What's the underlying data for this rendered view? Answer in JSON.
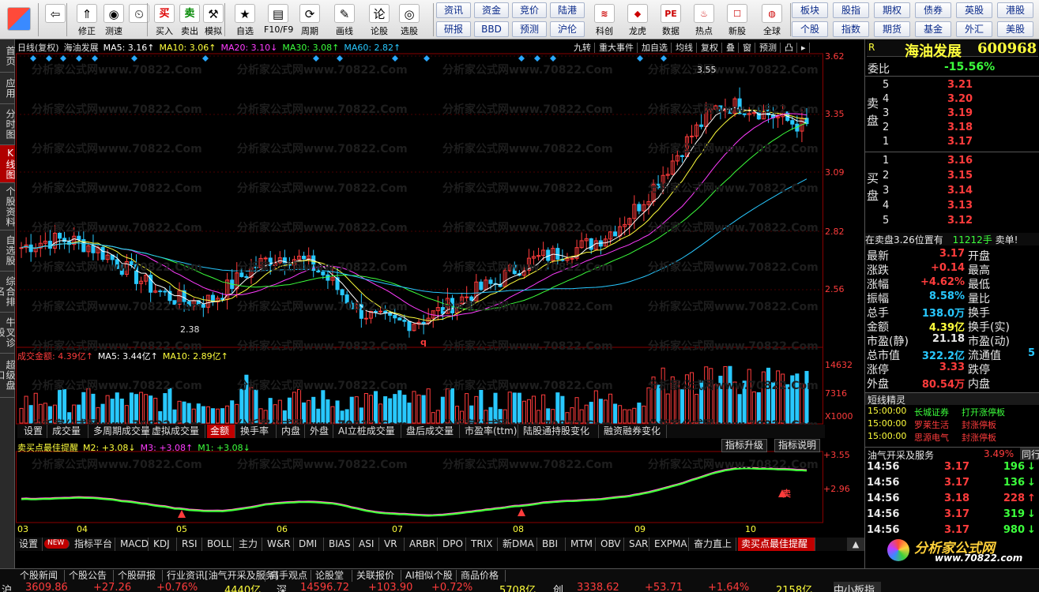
{
  "toolbar": {
    "buttons": [
      {
        "name": "back-button",
        "label": "",
        "icon": "⇦"
      },
      {
        "name": "revise-button",
        "label": "修正",
        "icon": "⇑"
      },
      {
        "name": "replay-button",
        "label": "测速",
        "icon": "◉"
      },
      {
        "name": "clock-button",
        "label": "",
        "icon": "⏲"
      },
      {
        "name": "buy-button",
        "label": "买入",
        "icon": "买"
      },
      {
        "name": "sell-button",
        "label": "卖出",
        "icon": "卖"
      },
      {
        "name": "simulate-button",
        "label": "模拟",
        "icon": "⚒"
      },
      {
        "name": "self-select-button",
        "label": "自选",
        "icon": "★"
      },
      {
        "name": "f10-button",
        "label": "F10/F9",
        "icon": "▤"
      },
      {
        "name": "period-button",
        "label": "周期",
        "icon": "⟳"
      },
      {
        "name": "draw-button",
        "label": "画线",
        "icon": "✎"
      },
      {
        "name": "discuss-button",
        "label": "论股",
        "icon": "论"
      },
      {
        "name": "select-stock-button",
        "label": "选股",
        "icon": "◎"
      }
    ],
    "small_buttons": [
      "资讯",
      "资金",
      "竞价",
      "陆港",
      "研报",
      "BBD",
      "预测",
      "沪伦"
    ],
    "icon_buttons": [
      {
        "name": "kechuang-button",
        "label": "科创",
        "icon": "≋"
      },
      {
        "name": "longhu-button",
        "label": "龙虎",
        "icon": "◆"
      },
      {
        "name": "data-button",
        "label": "数据",
        "icon": "PE"
      },
      {
        "name": "hotspot-button",
        "label": "热点",
        "icon": "♨"
      },
      {
        "name": "new-stock-button",
        "label": "新股",
        "icon": "☐"
      },
      {
        "name": "global-button",
        "label": "全球",
        "icon": "◍"
      }
    ],
    "right_buttons": [
      "板块",
      "股指",
      "期权",
      "债券",
      "英股",
      "港股",
      "个股",
      "指数",
      "期货",
      "基金",
      "外汇",
      "美股"
    ]
  },
  "left_nav": [
    {
      "label": "首页",
      "active": false
    },
    {
      "label": "应用",
      "active": false
    },
    {
      "label": "分时图",
      "active": false
    },
    {
      "label": "K线图",
      "active": true
    },
    {
      "label": "个股资料",
      "active": false
    },
    {
      "label": "自选股",
      "active": false
    },
    {
      "label": "综合排名",
      "active": false
    },
    {
      "label": "牛叉诊股",
      "active": false
    },
    {
      "label": "超级盘口",
      "active": false
    }
  ],
  "kline": {
    "header_items": [
      {
        "text": "日线(复权)",
        "color": "#e0e0e0"
      },
      {
        "text": "海油发展",
        "color": "#e0e0e0"
      },
      {
        "text": "MA5: 3.16↑",
        "color": "#ffffff"
      },
      {
        "text": "MA10: 3.06↑",
        "color": "#ffff3c"
      },
      {
        "text": "MA20: 3.10↓",
        "color": "#ff3cff"
      },
      {
        "text": "MA30: 3.08↑",
        "color": "#3cff3c"
      },
      {
        "text": "MA60: 2.82↑",
        "color": "#28c8ff"
      }
    ],
    "toolbar_items": [
      "九转",
      "重大事件",
      "加自选",
      "均线",
      "复权",
      "叠",
      "窗",
      "预测",
      "凸",
      "▸"
    ],
    "price_axis": [
      "3.62",
      "3.35",
      "3.09",
      "2.82",
      "2.56"
    ],
    "high_label": "3.55",
    "low_label": "2.38",
    "q_marker": "q"
  },
  "volume": {
    "header_items": [
      {
        "text": "成交金额: 4.39亿↑",
        "color": "#ff3c3c"
      },
      {
        "text": "MA5: 3.44亿↑",
        "color": "#ffffff"
      },
      {
        "text": "MA10: 2.89亿↑",
        "color": "#ffff3c"
      }
    ],
    "axis": [
      "14632",
      "7316",
      "X1000"
    ]
  },
  "tabs1": [
    "设置",
    "成交量",
    "多周期成交量",
    "虚拟成交量",
    "金额",
    "换手率",
    "内盘",
    "外盘",
    "AI立桩成交量",
    "盘后成交量",
    "市盈率(ttm)",
    "陆股通持股变化",
    "融资融券变化"
  ],
  "tabs1_active": "金额",
  "indicator": {
    "header_items": [
      {
        "text": "卖买点最佳提醒",
        "color": "#ffff3c"
      },
      {
        "text": "M2: +3.08↓",
        "color": "#ffff3c"
      },
      {
        "text": "M3: +3.08↑",
        "color": "#ff3cff"
      },
      {
        "text": "M1: +3.08↓",
        "color": "#3cff3c"
      }
    ],
    "buttons": [
      "指标升级",
      "指标说明"
    ],
    "axis": [
      "+3.55",
      "+2.96"
    ],
    "sell_label": "卖"
  },
  "months": [
    "03",
    "04",
    "05",
    "06",
    "07",
    "08",
    "09",
    "10"
  ],
  "tabs2": [
    "设置",
    "NEW",
    "指标平台",
    "MACD",
    "KDJ",
    "RSI",
    "BOLL",
    "主力",
    "W&R",
    "DMI",
    "BIAS",
    "ASI",
    "VR",
    "ARBR",
    "DPO",
    "TRIX",
    "新DMA",
    "BBI",
    "MTM",
    "OBV",
    "SAR",
    "EXPMA",
    "奋力直上",
    "卖买点最佳提醒"
  ],
  "tabs2_active": "卖买点最佳提醒",
  "right": {
    "name": "海油发展",
    "code": "600968",
    "weibi_label": "委比",
    "weibi": "-15.56%",
    "r_mark": "R",
    "sell_label": "卖盘",
    "buy_label": "买盘",
    "sell": [
      {
        "n": "5",
        "p": "3.21"
      },
      {
        "n": "4",
        "p": "3.20"
      },
      {
        "n": "3",
        "p": "3.19"
      },
      {
        "n": "2",
        "p": "3.18"
      },
      {
        "n": "1",
        "p": "3.17"
      }
    ],
    "buy": [
      {
        "n": "1",
        "p": "3.16"
      },
      {
        "n": "2",
        "p": "3.15"
      },
      {
        "n": "3",
        "p": "3.14"
      },
      {
        "n": "4",
        "p": "3.13"
      },
      {
        "n": "5",
        "p": "3.12"
      }
    ],
    "notice": [
      "在卖盘3.26位置有",
      "11212手",
      "卖单!"
    ],
    "stats": [
      {
        "k": "最新",
        "v": "3.17",
        "vc": "red",
        "k2": "开盘",
        "v2": ""
      },
      {
        "k": "涨跌",
        "v": "+0.14",
        "vc": "red",
        "k2": "最高",
        "v2": ""
      },
      {
        "k": "涨幅",
        "v": "+4.62%",
        "vc": "red",
        "k2": "最低",
        "v2": ""
      },
      {
        "k": "振幅",
        "v": "8.58%",
        "vc": "cyn",
        "k2": "量比",
        "v2": ""
      },
      {
        "k": "总手",
        "v": "138.0万",
        "vc": "cyn",
        "k2": "换手",
        "v2": ""
      },
      {
        "k": "金额",
        "v": "4.39亿",
        "vc": "yel",
        "k2": "换手(实)",
        "v2": ""
      },
      {
        "k": "市盈(静)",
        "v": "21.18",
        "vc": "wht",
        "k2": "市盈(动)",
        "v2": ""
      },
      {
        "k": "总市值",
        "v": "322.2亿",
        "vc": "cyn",
        "k2": "流通值",
        "v2": "5"
      },
      {
        "k": "涨停",
        "v": "3.33",
        "vc": "red",
        "k2": "跌停",
        "v2": ""
      },
      {
        "k": "外盘",
        "v": "80.54万",
        "vc": "red",
        "k2": "内盘",
        "v2": ""
      }
    ],
    "jingling_title": "短线精灵",
    "jingling": [
      {
        "t": "15:00:00",
        "s": "长城证券",
        "e": "打开涨停板",
        "sc": "#3cff3c",
        "ec": "#3cff3c"
      },
      {
        "t": "15:00:00",
        "s": "罗莱生活",
        "e": "封涨停板",
        "sc": "#ff3c3c",
        "ec": "#ff3c3c"
      },
      {
        "t": "15:00:00",
        "s": "思源电气",
        "e": "封涨停板",
        "sc": "#ff3c3c",
        "ec": "#ff3c3c"
      }
    ],
    "sector": "油气开采及服务",
    "sector_pct": "3.49%",
    "peer_btn": "同行",
    "ticks": [
      {
        "t": "14:56",
        "p": "3.17",
        "v": "196",
        "d": "↓",
        "c": "grn"
      },
      {
        "t": "14:56",
        "p": "3.17",
        "v": "136",
        "d": "↓",
        "c": "grn"
      },
      {
        "t": "14:56",
        "p": "3.18",
        "v": "228",
        "d": "↑",
        "c": "red"
      },
      {
        "t": "14:56",
        "p": "3.17",
        "v": "319",
        "d": "↓",
        "c": "grn"
      },
      {
        "t": "14:56",
        "p": "3.17",
        "v": "980",
        "d": "↓",
        "c": "grn"
      }
    ],
    "logo": "分析家公式网",
    "logo_url": "www.70822.com"
  },
  "bottom_tabs": [
    "个股新闻",
    "个股公告",
    "个股研报",
    "行业资讯[油气开采及服务]",
    "高手观点",
    "论股堂",
    "关联报价",
    "AI相似个股",
    "商品价格"
  ],
  "ticker": [
    {
      "name": "沪",
      "v": "3609.86",
      "c": "+27.26",
      "p": "+0.76%",
      "a": "4440亿"
    },
    {
      "name": "深",
      "v": "14596.72",
      "c": "+103.90",
      "p": "+0.72%",
      "a": "5708亿"
    },
    {
      "name": "创",
      "v": "3338.62",
      "c": "+53.71",
      "p": "+1.64%",
      "a": "2158亿"
    }
  ],
  "ticker_right": "中小板指",
  "watermark": "分析家公式网www.70822.Com",
  "colors": {
    "up": "#ff3c3c",
    "down": "#28c8ff",
    "accent": "#c00000"
  }
}
